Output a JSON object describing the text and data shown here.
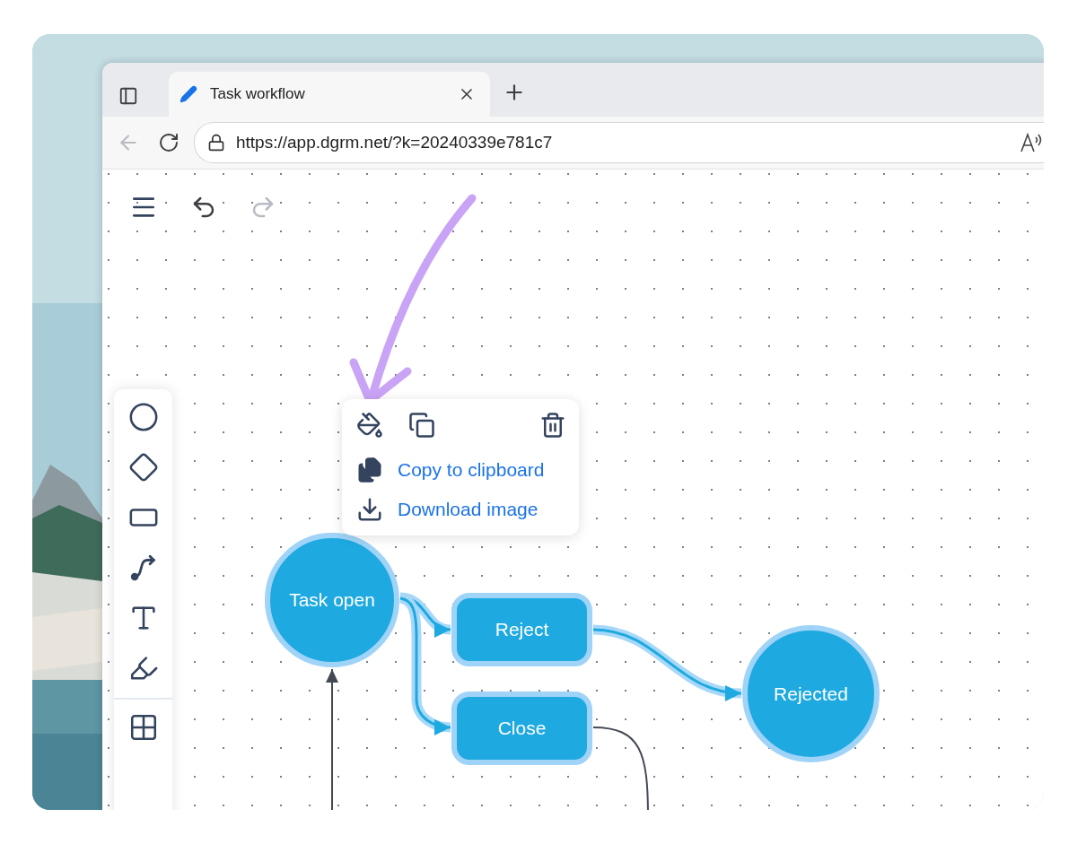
{
  "browser": {
    "tab": {
      "title": "Task workflow",
      "selected": true
    },
    "address": "https://app.dgrm.net/?k=20240339e781c7",
    "back": {
      "disabled": true
    }
  },
  "toolbar": {
    "undo": {
      "disabled": false
    },
    "redo": {
      "disabled": true
    }
  },
  "tools": [
    {
      "kind": "circle"
    },
    {
      "kind": "diamond"
    },
    {
      "kind": "rect"
    },
    {
      "kind": "connector"
    },
    {
      "kind": "text"
    },
    {
      "kind": "pen"
    },
    {
      "kind": "divider"
    },
    {
      "kind": "grid"
    }
  ],
  "context_menu": {
    "actions": [
      {
        "kind": "fill"
      },
      {
        "kind": "duplicate"
      },
      {
        "kind": "delete"
      }
    ],
    "items": [
      {
        "kind": "copy",
        "label": "Copy to clipboard"
      },
      {
        "kind": "download",
        "label": "Download image"
      }
    ]
  },
  "diagram": {
    "nodes": [
      {
        "kind": "circle",
        "label": "Task open",
        "selected": true
      },
      {
        "kind": "rect",
        "label": "Reject",
        "selected": true
      },
      {
        "kind": "rect",
        "label": "Close",
        "selected": true
      },
      {
        "kind": "circle",
        "label": "Rejected",
        "selected": true
      }
    ],
    "edges": [
      {
        "selected": false
      },
      {
        "selected": true
      },
      {
        "selected": true
      },
      {
        "selected": true
      },
      {
        "selected": false
      }
    ]
  }
}
